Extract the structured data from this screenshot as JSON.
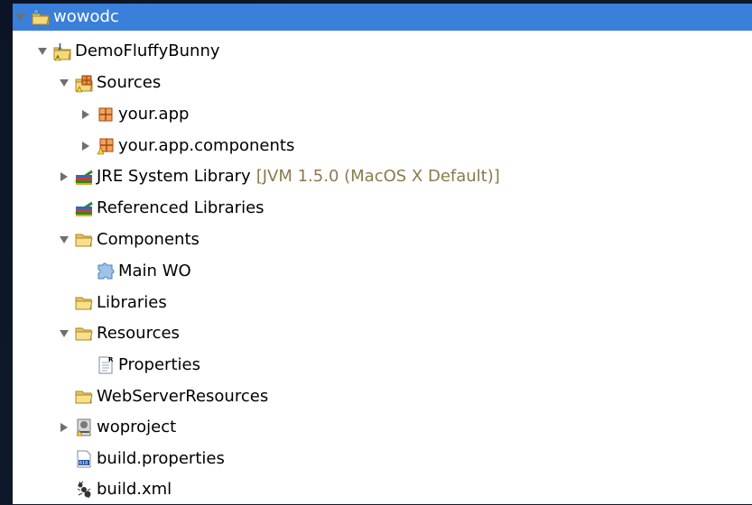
{
  "tree": {
    "items": [
      {
        "label": "wowodc",
        "icon": "workspace-folder-icon",
        "depth": 0,
        "expanded": true,
        "selected": true
      },
      {
        "label": "DemoFluffyBunny",
        "icon": "java-project-icon",
        "depth": 1,
        "expanded": true
      },
      {
        "label": "Sources",
        "icon": "source-folder-icon",
        "depth": 2,
        "expanded": true
      },
      {
        "label": "your.app",
        "icon": "package-icon",
        "depth": 3,
        "expanded": false
      },
      {
        "label": "your.app.components",
        "icon": "package-warning-icon",
        "depth": 3,
        "expanded": false
      },
      {
        "label": "JRE System Library",
        "extra": "[JVM 1.5.0 (MacOS X Default)]",
        "icon": "library-icon",
        "depth": 2,
        "expanded": false
      },
      {
        "label": "Referenced Libraries",
        "icon": "library-icon",
        "depth": 2,
        "expanded": null
      },
      {
        "label": "Components",
        "icon": "folder-open-icon",
        "depth": 2,
        "expanded": true
      },
      {
        "label": "Main WO",
        "icon": "wo-component-icon",
        "depth": 3,
        "expanded": null
      },
      {
        "label": "Libraries",
        "icon": "folder-open-icon",
        "depth": 2,
        "expanded": null
      },
      {
        "label": "Resources",
        "icon": "folder-open-icon",
        "depth": 2,
        "expanded": true
      },
      {
        "label": "Properties",
        "icon": "properties-file-icon",
        "depth": 3,
        "expanded": null
      },
      {
        "label": "WebServerResources",
        "icon": "folder-open-icon",
        "depth": 2,
        "expanded": null
      },
      {
        "label": "woproject",
        "icon": "woproject-icon",
        "depth": 2,
        "expanded": false
      },
      {
        "label": "build.properties",
        "icon": "binary-file-icon",
        "depth": 2,
        "expanded": null
      },
      {
        "label": "build.xml",
        "icon": "ant-file-icon",
        "depth": 2,
        "expanded": null
      }
    ]
  },
  "colors": {
    "selection": "#3a7fd9",
    "decoration": "#8a7a4e",
    "background": "#0f1a2e"
  }
}
